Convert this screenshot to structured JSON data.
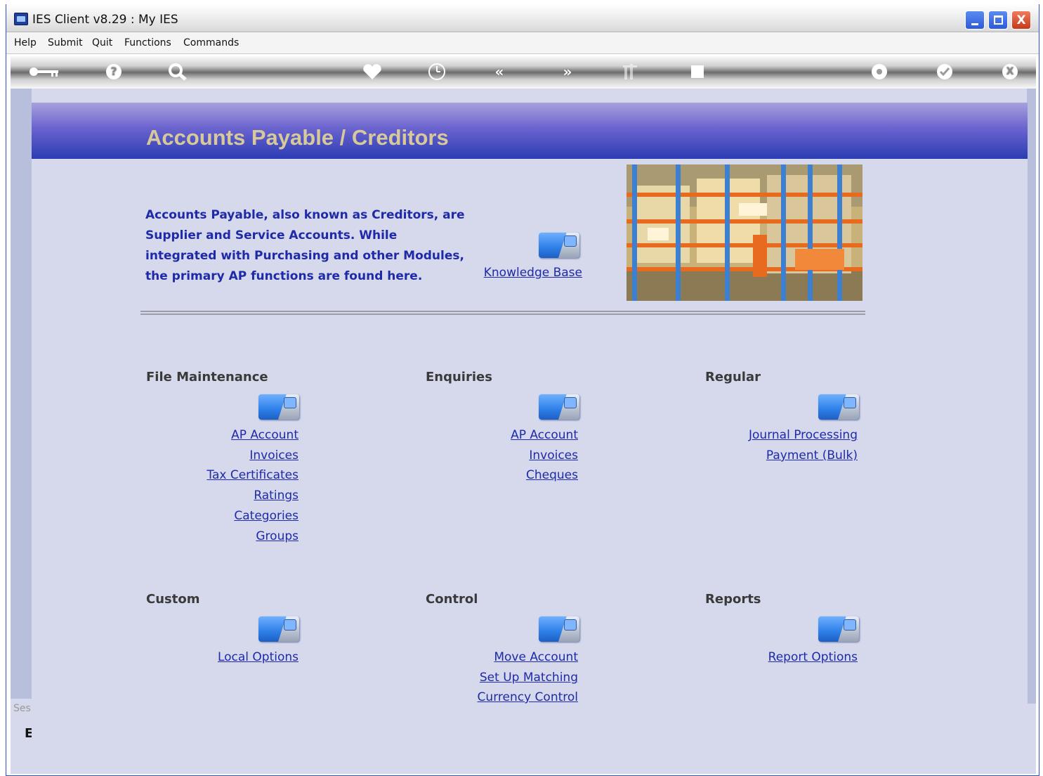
{
  "window": {
    "title": "IES Client v8.29 : My IES",
    "minimize_label": "_",
    "maximize_label": "□",
    "close_label": "X"
  },
  "menubar": {
    "items": [
      "Help",
      "Submit",
      "Quit",
      "Functions",
      "Commands"
    ]
  },
  "toolbar": {
    "icons": [
      "key-icon",
      "help-icon",
      "search-icon",
      "heart-icon",
      "clock-icon",
      "back-icon",
      "forward-icon",
      "sort-icon",
      "stop-icon",
      "settings-icon",
      "ok-icon",
      "close-icon"
    ],
    "glyphs": {
      "help": "?",
      "back": "«",
      "forward": "»",
      "ok": "✓",
      "close": "X"
    }
  },
  "sidebar": {
    "partial_text": "Ses",
    "partial_glyph": "E"
  },
  "page": {
    "title": "Accounts Payable / Creditors",
    "intro_lines": [
      "Accounts Payable, also known as Creditors, are",
      "Supplier and Service Accounts. While",
      "integrated with Purchasing and other Modules,",
      "the primary AP functions are found here."
    ],
    "knowledge_base_link": "Knowledge Base",
    "image_subject": "warehouse-shelving-image"
  },
  "sections": [
    {
      "heading": "File Maintenance",
      "links": [
        "AP Account",
        "Invoices",
        "Tax Certificates",
        "Ratings",
        "Categories",
        "Groups"
      ]
    },
    {
      "heading": "Enquiries",
      "links": [
        "AP Account",
        "Invoices",
        "Cheques"
      ]
    },
    {
      "heading": "Regular",
      "links": [
        "Journal Processing",
        "Payment (Bulk)"
      ]
    },
    {
      "heading": "Custom",
      "links": [
        "Local Options"
      ]
    },
    {
      "heading": "Control",
      "links": [
        "Move Account",
        "Set Up Matching",
        "Currency Control"
      ]
    },
    {
      "heading": "Reports",
      "links": [
        "Report Options"
      ]
    }
  ],
  "colors": {
    "link": "#1e2aa8",
    "title_text": "#d7c99a",
    "header_top": "#a7a1dd",
    "header_bottom": "#2b3cb3",
    "panel_bg": "#d6d9eb"
  }
}
